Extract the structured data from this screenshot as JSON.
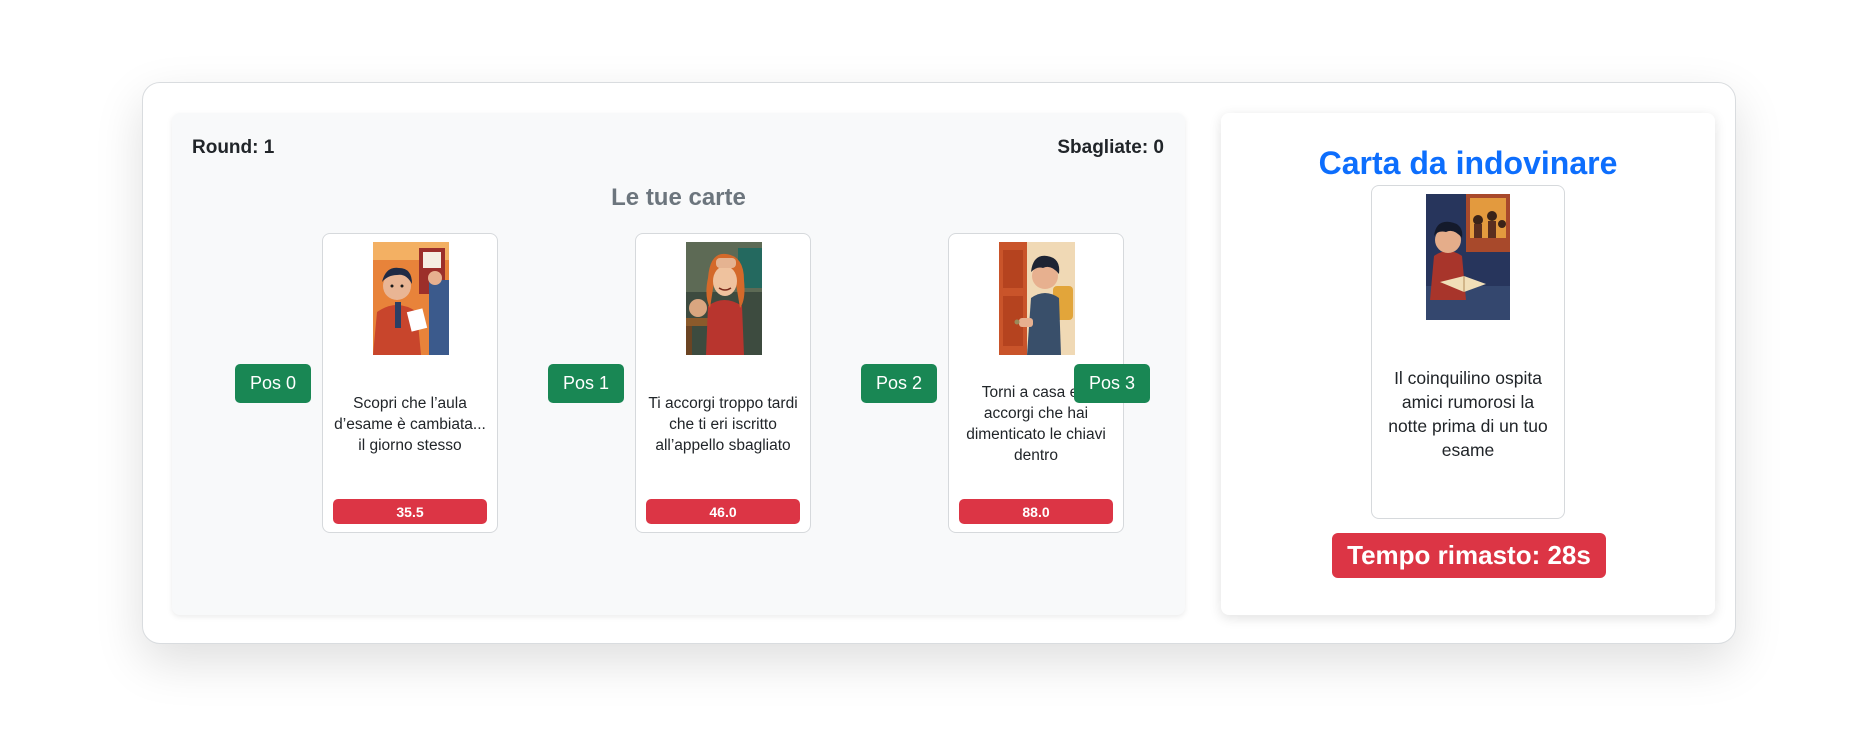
{
  "status": {
    "round_label": "Round: 1",
    "wrong_label": "Sbagliate: 0"
  },
  "hand": {
    "title": "Le tue carte",
    "positions": [
      "Pos 0",
      "Pos 1",
      "Pos 2",
      "Pos 3"
    ],
    "cards": [
      {
        "text": "Scopri che l’aula d’esame è cambiata... il giorno stesso",
        "value": "35.5"
      },
      {
        "text": "Ti accorgi troppo tardi che ti eri iscritto all’appello sbagliato",
        "value": "46.0"
      },
      {
        "text": "Torni a casa e ti accorgi che hai dimenticato le chiavi dentro",
        "value": "88.0"
      }
    ]
  },
  "target": {
    "title": "Carta da indovinare",
    "card_text": "Il coinquilino ospita amici rumorosi la notte prima di un tuo esame",
    "timer": "Tempo rimasto: 28s"
  },
  "colors": {
    "position_button": "#198754",
    "value_badge": "#dc3545",
    "timer": "#dc3545",
    "target_title": "#0d6efd",
    "hand_title": "#6c757d"
  }
}
